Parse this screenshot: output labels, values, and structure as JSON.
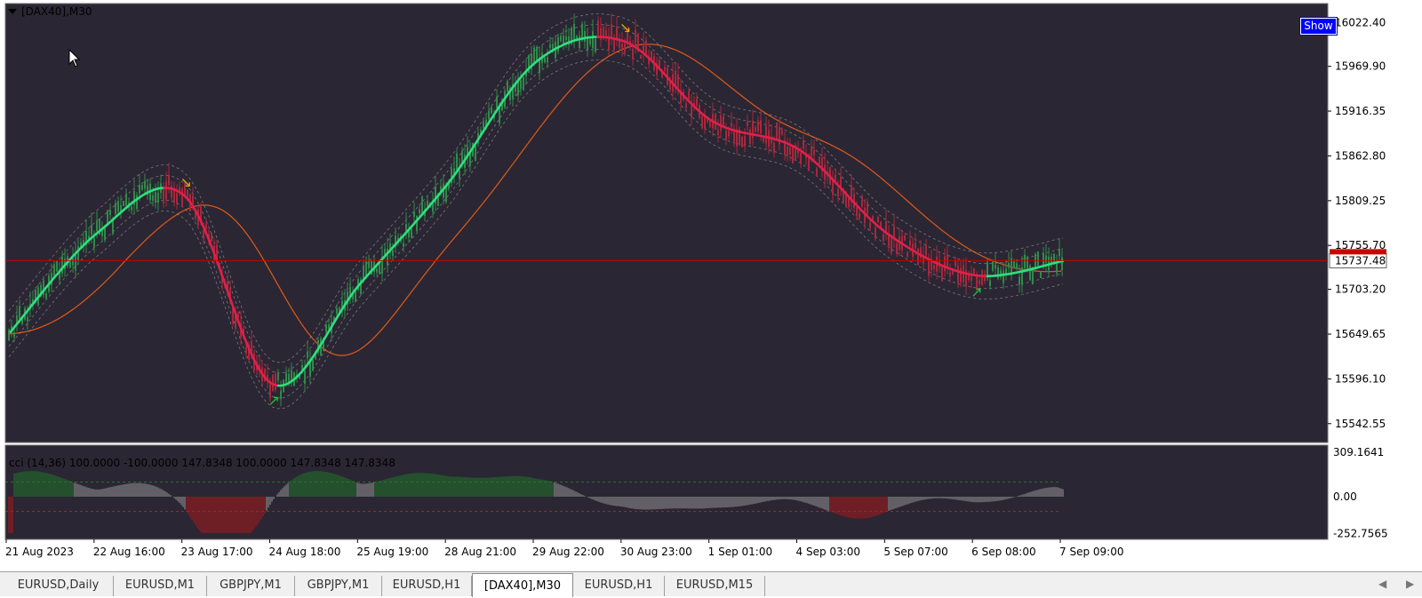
{
  "window": {
    "symbol_title": "[DAX40],M30",
    "show_button_label": "Show",
    "collapse_icon": "triangle-down"
  },
  "price_axis": {
    "labels": [
      "16022.40",
      "15969.90",
      "15916.35",
      "15862.80",
      "15809.25",
      "15755.70",
      "15703.20",
      "15649.65",
      "15596.10",
      "15542.55"
    ],
    "current_price": "15737.48",
    "current_price_line_color": "#cc0000"
  },
  "time_axis": {
    "labels": [
      "21 Aug 2023",
      "22 Aug 16:00",
      "23 Aug 17:00",
      "24 Aug 18:00",
      "25 Aug 19:00",
      "28 Aug 21:00",
      "29 Aug 22:00",
      "30 Aug 23:00",
      "1 Sep 01:00",
      "4 Sep 03:00",
      "5 Sep 07:00",
      "6 Sep 08:00",
      "7 Sep 09:00"
    ]
  },
  "indicator": {
    "label": "cci  (14,36) 100.0000 -100.0000 147.8348 100.0000 147.8348 147.8348",
    "axis_labels": [
      "309.1641",
      "0.00",
      "-252.7565"
    ],
    "levels": [
      100,
      -100
    ]
  },
  "colors": {
    "chart_background": "#2b2633",
    "bull_candle": "#2f8a4a",
    "bear_candle": "#a8283c",
    "trend_up_line": "#2ee07f",
    "trend_down_line": "#e0204a",
    "moving_average": "#e05a1a",
    "envelope": "#9a9aa0",
    "buy_arrow": "#22c03a",
    "sell_arrow": "#f0a000",
    "cci_positive": "#1f7a2a",
    "cci_negative": "#b01818",
    "cci_neutral": "#9a9a9a"
  },
  "chart_data": {
    "type": "line",
    "title": "[DAX40],M30",
    "x": [
      "21 Aug 2023",
      "22 Aug 16:00",
      "23 Aug 17:00",
      "24 Aug 18:00",
      "25 Aug 19:00",
      "28 Aug 21:00",
      "29 Aug 22:00",
      "30 Aug 23:00",
      "1 Sep 01:00",
      "4 Sep 03:00",
      "5 Sep 07:00",
      "6 Sep 08:00",
      "7 Sep 09:00"
    ],
    "series": [
      {
        "values": [
          15650,
          15770,
          15815,
          15590,
          15710,
          15830,
          15975,
          16000,
          15905,
          15870,
          15770,
          15720,
          15737
        ]
      }
    ],
    "ylim": [
      15520,
      16045
    ],
    "grid": false
  },
  "tabs": [
    {
      "label": "EURUSD,Daily",
      "active": false
    },
    {
      "label": "EURUSD,M1",
      "active": false
    },
    {
      "label": "GBPJPY,M1",
      "active": false
    },
    {
      "label": "GBPJPY,M1",
      "active": false
    },
    {
      "label": "EURUSD,H1",
      "active": false
    },
    {
      "label": "[DAX40],M30",
      "active": true
    },
    {
      "label": "EURUSD,H1",
      "active": false
    },
    {
      "label": "EURUSD,M15",
      "active": false
    }
  ]
}
